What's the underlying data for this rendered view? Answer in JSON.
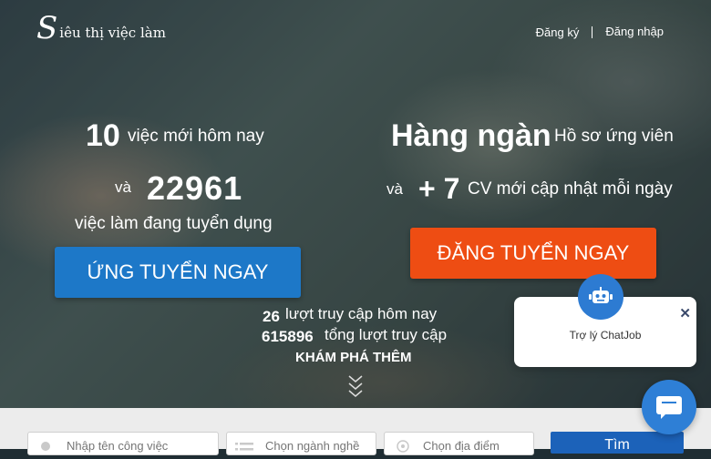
{
  "brand": {
    "logo_mark": "S",
    "logo_text": "iêu thị việc làm"
  },
  "header": {
    "register": "Đăng ký",
    "login": "Đăng nhập"
  },
  "left": {
    "jobs_new_count": "10",
    "jobs_new_label": "việc mới hôm nay",
    "and": "và",
    "jobs_total": "22961",
    "jobs_total_label": "việc làm đang tuyển dụng",
    "apply_button": "ỨNG TUYỂN NGAY"
  },
  "right": {
    "headline": "Hàng ngàn",
    "headline_label": "Hồ sơ ứng viên",
    "and": "và",
    "cv_count": "+ 7",
    "cv_label": "CV mới cập nhật mỗi ngày",
    "post_button": "ĐĂNG TUYỂN NGAY"
  },
  "stats": {
    "today_count": "26",
    "today_label": "lượt truy cập hôm nay",
    "total_count": "615896",
    "total_label": "tổng lượt truy cập",
    "explore": "KHÁM PHÁ THÊM"
  },
  "chat": {
    "title": "Trợ lý ChatJob",
    "close": "✕"
  },
  "search": {
    "keyword_placeholder": "Nhập tên công việc",
    "category_placeholder": "Chọn ngành nghề",
    "location_placeholder": "Chọn địa điểm",
    "button": "Tìm"
  },
  "colors": {
    "apply": "#1d78c8",
    "post": "#ee4d13",
    "chat": "#2e7fd6",
    "search": "#1c62b9"
  }
}
